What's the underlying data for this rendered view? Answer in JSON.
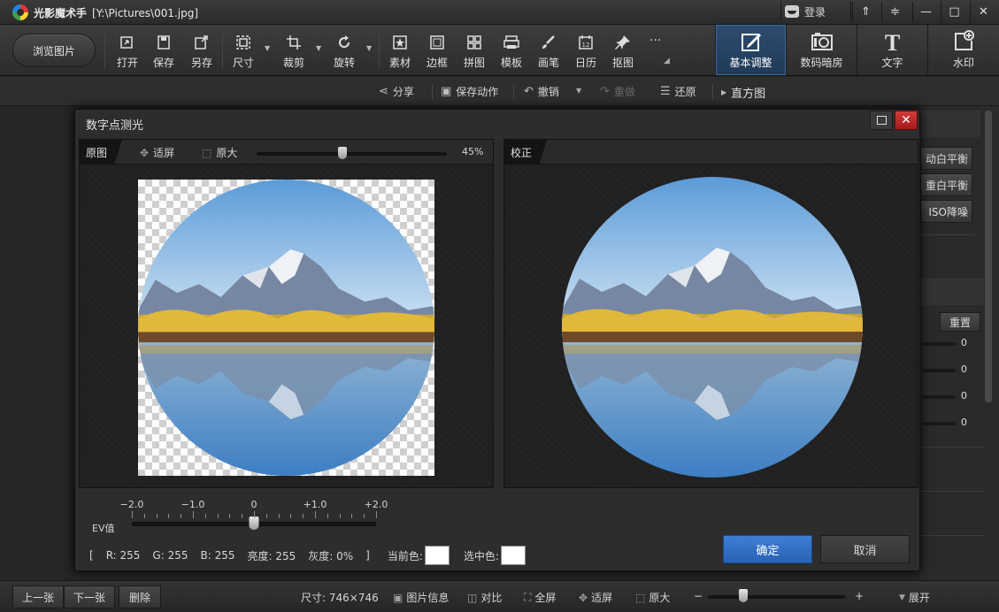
{
  "titlebar": {
    "app_name": "光影魔术手",
    "file_path": "[Y:\\Pictures\\001.jpg]",
    "login_label": "登录",
    "buttons": {
      "skin": "⇑",
      "menu": "≑",
      "minimize": "—",
      "maximize": "□",
      "close": "✕"
    }
  },
  "toolbar": {
    "browse_label": "浏览图片",
    "tools": [
      {
        "label": "打开",
        "icon": "open-icon"
      },
      {
        "label": "保存",
        "icon": "save-icon"
      },
      {
        "label": "另存",
        "icon": "save-as-icon"
      },
      {
        "label": "尺寸",
        "icon": "resize-icon"
      },
      {
        "label": "裁剪",
        "icon": "crop-icon"
      },
      {
        "label": "旋转",
        "icon": "rotate-icon"
      },
      {
        "label": "素材",
        "icon": "material-icon"
      },
      {
        "label": "边框",
        "icon": "frame-icon"
      },
      {
        "label": "拼图",
        "icon": "collage-icon"
      },
      {
        "label": "模板",
        "icon": "template-icon"
      },
      {
        "label": "画笔",
        "icon": "brush-icon"
      },
      {
        "label": "日历",
        "icon": "calendar-icon"
      },
      {
        "label": "抠图",
        "icon": "cutout-icon"
      }
    ],
    "more_label": "···",
    "calendar_number": "12",
    "tabs": [
      {
        "label": "基本调整",
        "icon": "adjust-icon",
        "active": true
      },
      {
        "label": "数码暗房",
        "icon": "darkroom-icon",
        "active": false
      },
      {
        "label": "文字",
        "icon": "text-icon",
        "glyph": "T",
        "active": false
      },
      {
        "label": "水印",
        "icon": "watermark-icon",
        "active": false
      }
    ]
  },
  "actionbar": {
    "share": "分享",
    "save_action": "保存动作",
    "undo": "撤销",
    "redo": "重做",
    "restore": "还原",
    "histogram": "直方图"
  },
  "right_panel": {
    "buttons": [
      "动白平衡",
      "重白平衡",
      "ISO降噪"
    ],
    "reset_label": "重置",
    "values": [
      "0",
      "0",
      "0",
      "0"
    ]
  },
  "dialog": {
    "title": "数字点测光",
    "original_tag": "原图",
    "corrected_tag": "校正",
    "fit_label": "适屏",
    "actual_label": "原大",
    "zoom_value": "45%",
    "zoom_fraction": 0.24,
    "ev_label": "EV值",
    "ev_ticks": [
      "−2.0",
      "−1.0",
      "0",
      "+1.0",
      "+2.0"
    ],
    "ev_value": 0,
    "color_info": {
      "open_bracket": "[",
      "r": "R: 255",
      "g": "G: 255",
      "b": "B: 255",
      "brightness": "亮度: 255",
      "gray": "灰度: 0%",
      "close_bracket": "]",
      "current_color_label": "当前色:",
      "current_color": "#ffffff",
      "selected_color_label": "选中色:",
      "selected_color": "#ffffff"
    },
    "ok_label": "确定",
    "cancel_label": "取消"
  },
  "statusbar": {
    "prev": "上一张",
    "next": "下一张",
    "delete": "删除",
    "size_label": "尺寸: 746×746",
    "info": "图片信息",
    "compare": "对比",
    "fullscreen": "全屏",
    "fit": "适屏",
    "actual": "原大",
    "minus": "−",
    "plus": "+",
    "expand": "展开"
  },
  "colors": {
    "accent": "#2f6fc6",
    "close_red": "#c62828",
    "active_tab": "#2a4a70"
  }
}
